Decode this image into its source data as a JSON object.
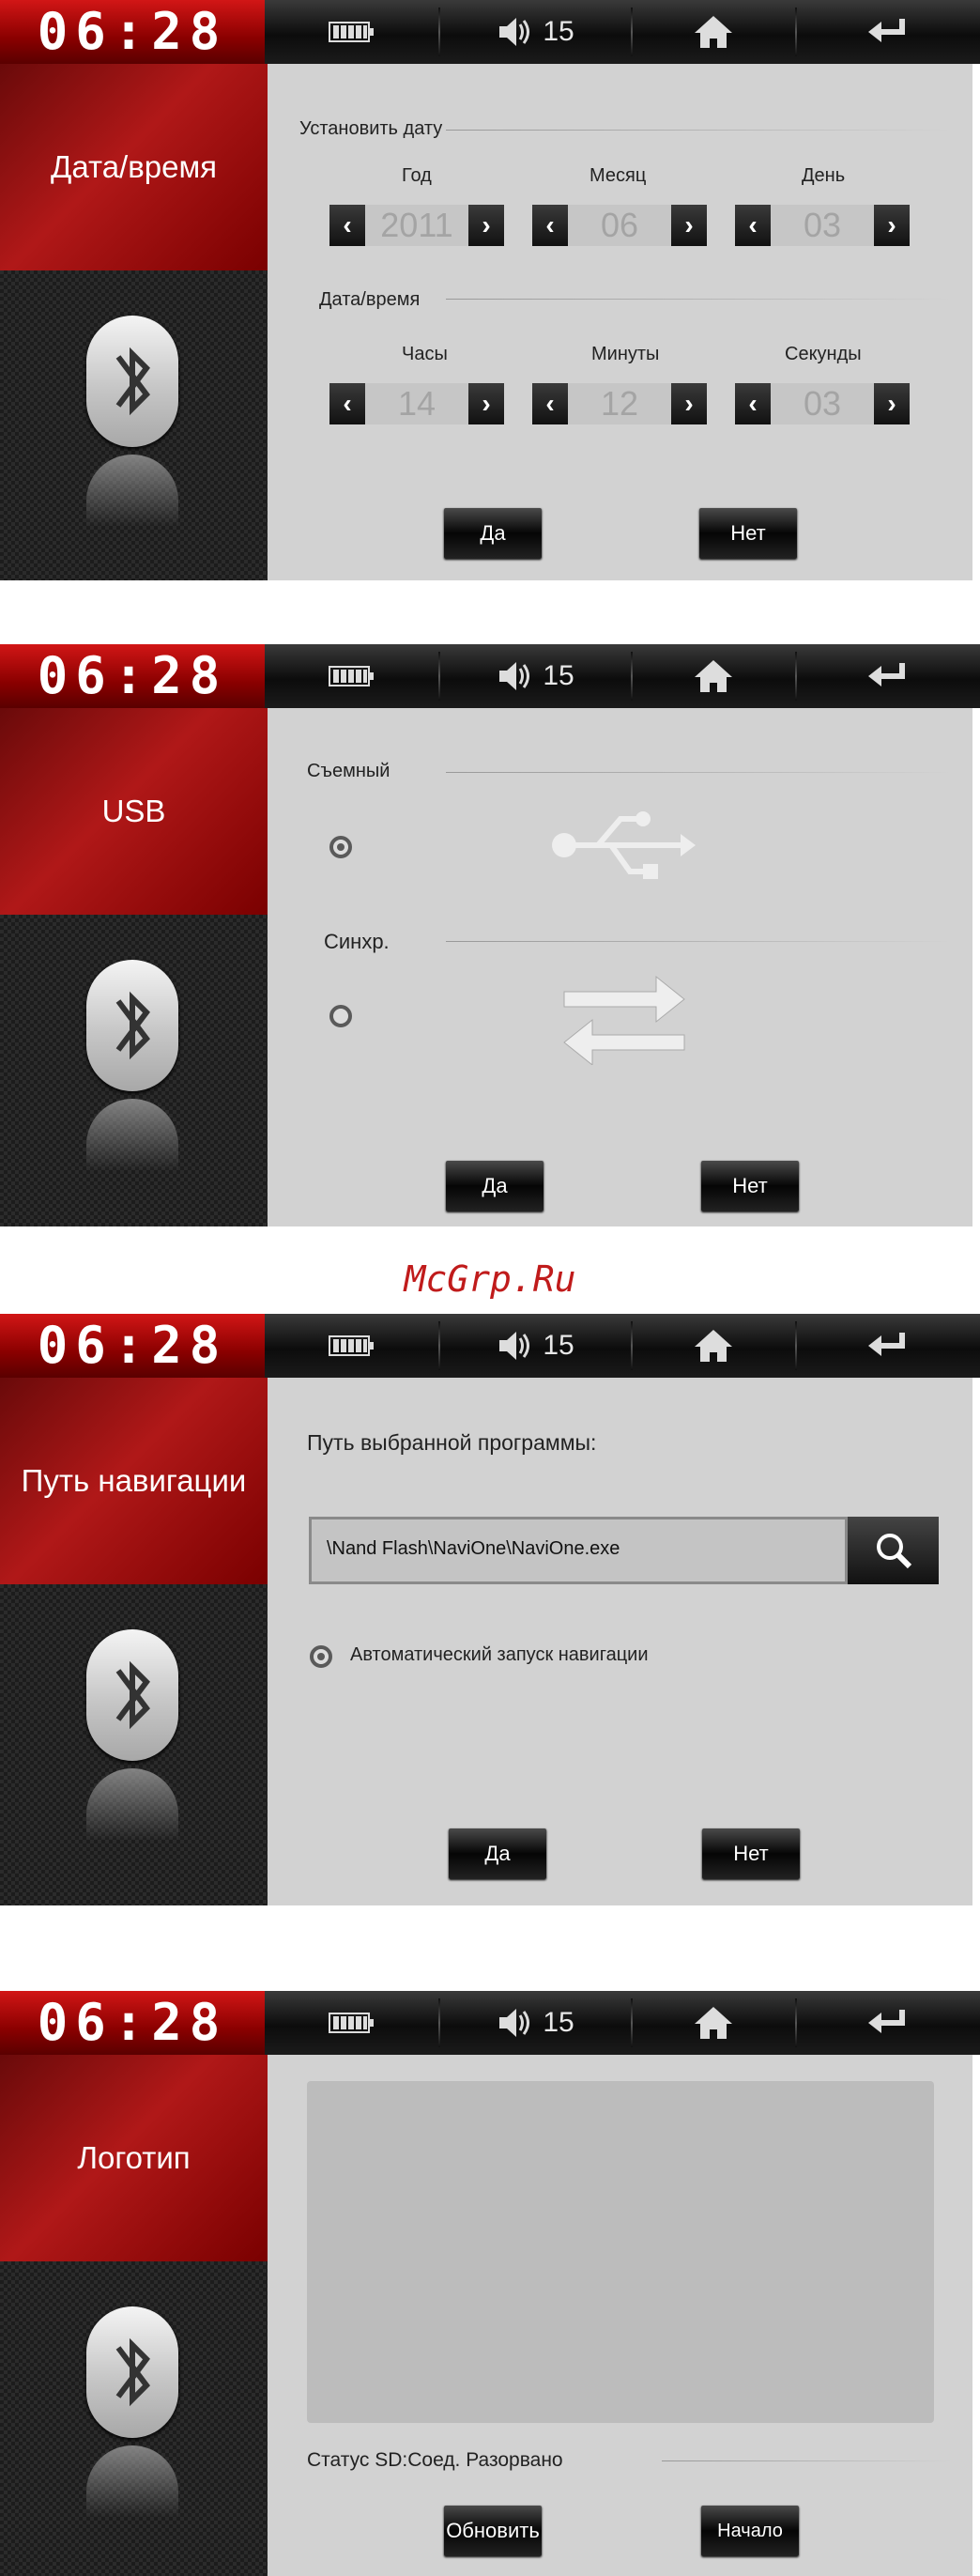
{
  "common": {
    "clock": "06:28",
    "volume": "15"
  },
  "watermark": "McGrp.Ru",
  "date_screen": {
    "title": "Дата/время",
    "set_date_label": "Установить дату",
    "year_label": "Год",
    "month_label": "Месяц",
    "day_label": "День",
    "year": "2011",
    "month": "06",
    "day": "03",
    "time_section_label": "Дата/время",
    "hours_label": "Часы",
    "minutes_label": "Минуты",
    "seconds_label": "Секунды",
    "hours": "14",
    "minutes": "12",
    "seconds": "03",
    "yes": "Да",
    "no": "Нет"
  },
  "usb_screen": {
    "title": "USB",
    "removable_label": "Съемный",
    "sync_label": "Синхр.",
    "selected": "removable",
    "yes": "Да",
    "no": "Нет"
  },
  "nav_screen": {
    "title": "Путь навигации",
    "path_label": "Путь выбранной программы:",
    "path_value": "\\Nand Flash\\NaviOne\\NaviOne.exe",
    "autostart_label": "Автоматический запуск навигации",
    "autostart": true,
    "yes": "Да",
    "no": "Нет"
  },
  "logo_screen": {
    "title": "Логотип",
    "status_label": "Статус SD:Соед. Разорвано",
    "refresh": "Обновить",
    "start": "Начало"
  },
  "icons": [
    "battery-icon",
    "volume-icon",
    "home-icon",
    "back-icon",
    "bluetooth-icon",
    "usb-icon",
    "sync-arrows-icon",
    "search-icon"
  ]
}
